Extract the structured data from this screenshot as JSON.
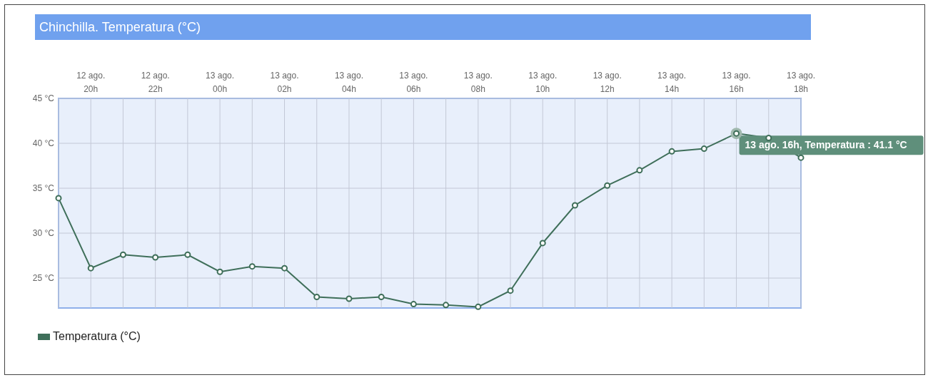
{
  "title": "Chinchilla. Temperatura (°C)",
  "chart_data": {
    "type": "line",
    "categories": [
      null,
      "12 ago. 20h",
      null,
      "12 ago. 22h",
      null,
      "13 ago. 00h",
      null,
      "13 ago. 02h",
      null,
      "13 ago. 04h",
      null,
      "13 ago. 06h",
      null,
      "13 ago. 08h",
      null,
      "13 ago. 10h",
      null,
      "13 ago. 12h",
      null,
      "13 ago. 14h",
      null,
      "13 ago. 16h",
      null,
      "13 ago. 18h"
    ],
    "ylim": [
      21.67,
      45
    ],
    "grid": true,
    "yticks": [
      {
        "value": 25,
        "label": "25 °C"
      },
      {
        "value": 30,
        "label": "30 °C"
      },
      {
        "value": 35,
        "label": "35 °C"
      },
      {
        "value": 40,
        "label": "40 °C"
      },
      {
        "value": 45,
        "label": "45 °C"
      }
    ],
    "series": [
      {
        "name": "Temperatura (°C)",
        "color": "#3f6f5a",
        "marker": "circle",
        "values": [
          33.9,
          26.1,
          27.6,
          27.3,
          27.6,
          25.7,
          26.3,
          26.1,
          22.9,
          22.7,
          22.9,
          22.1,
          22.0,
          21.8,
          23.6,
          28.9,
          33.1,
          35.3,
          37.0,
          39.1,
          39.4,
          41.1,
          40.6,
          38.4
        ]
      }
    ],
    "annotations": [
      {
        "x": "13 ago. 16h",
        "y": 41.1,
        "text": "13 ago. 16h, Temperatura : 41.1 °C"
      }
    ]
  }
}
